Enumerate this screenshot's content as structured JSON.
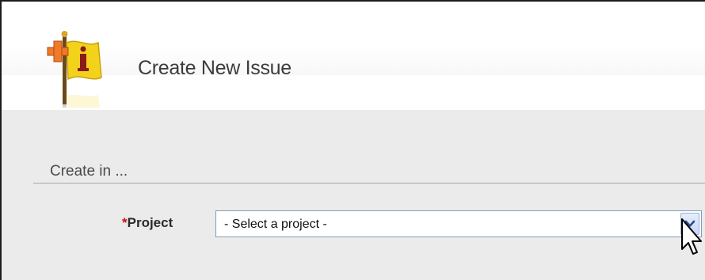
{
  "page": {
    "title": "Create New Issue"
  },
  "section": {
    "label": "Create in ..."
  },
  "form": {
    "project": {
      "required_marker": "*",
      "label": "Project",
      "selected_value": "- Select a project -"
    }
  },
  "icons": {
    "logo": "new-issue-flag-icon",
    "dropdown": "chevron-down-icon",
    "cursor": "mouse-pointer-icon"
  },
  "colors": {
    "required": "#cc1111",
    "flag_yellow": "#f3d21b",
    "plus_orange": "#f07a2a",
    "select_border": "#7f9db9"
  }
}
